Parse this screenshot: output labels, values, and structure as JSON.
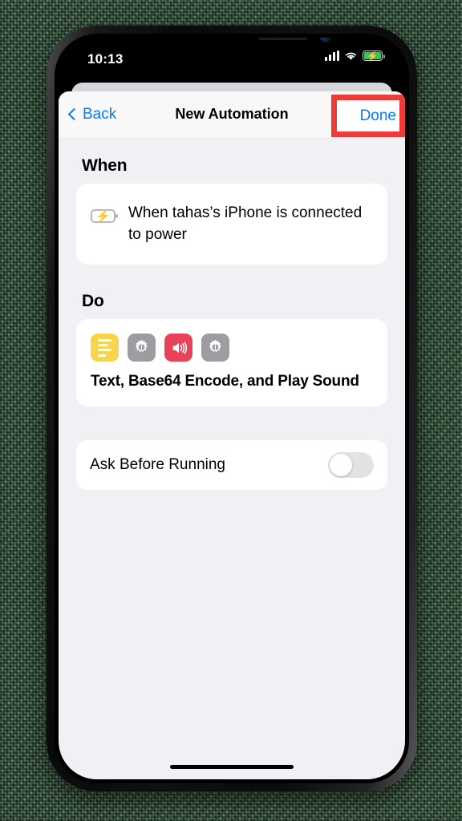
{
  "status_bar": {
    "time": "10:13",
    "signal_icon": "cellular-signal-icon",
    "wifi_icon": "wifi-icon",
    "battery_icon": "battery-charging-icon",
    "battery_bolt": "⚡"
  },
  "nav": {
    "back_label": "Back",
    "back_icon": "chevron-left-icon",
    "title": "New Automation",
    "done_label": "Done",
    "done_color": "#007aff",
    "highlight_color": "#ef3b38"
  },
  "sections": {
    "when": {
      "heading": "When",
      "trigger_icon": "battery-charging-icon",
      "trigger_bolt": "⚡",
      "trigger_text": "When tahas’s iPhone is connected to power"
    },
    "do": {
      "heading": "Do",
      "actions_text": "Text, Base64 Encode, and Play Sound",
      "icons": [
        {
          "name": "text-action-icon",
          "color": "#f8d44c",
          "glyph": ""
        },
        {
          "name": "gear-action-icon",
          "color": "#9c9ca1",
          "glyph": "⚙"
        },
        {
          "name": "play-sound-action-icon",
          "color": "#e8415a",
          "glyph": "🔊"
        },
        {
          "name": "gear-action-icon",
          "color": "#9c9ca1",
          "glyph": "⚙"
        }
      ]
    },
    "ask_before_running": {
      "label": "Ask Before Running",
      "toggle_state": "off",
      "track_color": "#e3e3e6"
    }
  },
  "device": {
    "home_indicator": "home-indicator",
    "notch": "notch-speaker-camera"
  }
}
